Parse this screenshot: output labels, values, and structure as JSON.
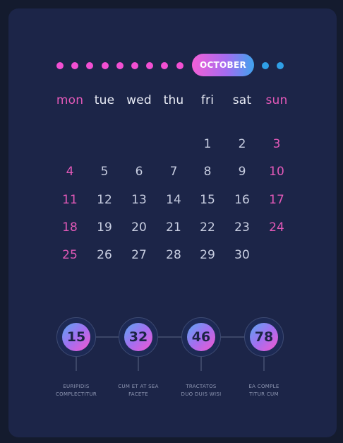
{
  "calendar": {
    "month": "OCTOBER",
    "month_dots_before": 9,
    "month_dots_after": 2,
    "weekdays": [
      "mon",
      "tue",
      "wed",
      "thu",
      "fri",
      "sat",
      "sun"
    ],
    "weeks": [
      [
        "",
        "",
        "",
        "",
        "1",
        "2",
        "3"
      ],
      [
        "4",
        "5",
        "6",
        "7",
        "8",
        "9",
        "10"
      ],
      [
        "11",
        "12",
        "13",
        "14",
        "15",
        "16",
        "17"
      ],
      [
        "18",
        "19",
        "20",
        "21",
        "22",
        "23",
        "24"
      ],
      [
        "25",
        "26",
        "27",
        "28",
        "29",
        "30",
        ""
      ]
    ]
  },
  "stats": [
    {
      "value": "15",
      "label": [
        "EURIPIDIS",
        "COMPLECTITUR"
      ]
    },
    {
      "value": "32",
      "label": [
        "CUM ET AT SEA",
        "FACETE"
      ]
    },
    {
      "value": "46",
      "label": [
        "TRACTATOS",
        "DUO DUIS WISI"
      ]
    },
    {
      "value": "78",
      "label": [
        "EA COMPLE",
        "TITUR CUM"
      ]
    }
  ],
  "colors": {
    "background": "#141b2e",
    "card": "#1c2548",
    "accent_pink": "#f24fd2",
    "accent_blue": "#2f9fe6",
    "weekend": "#e259b8"
  }
}
